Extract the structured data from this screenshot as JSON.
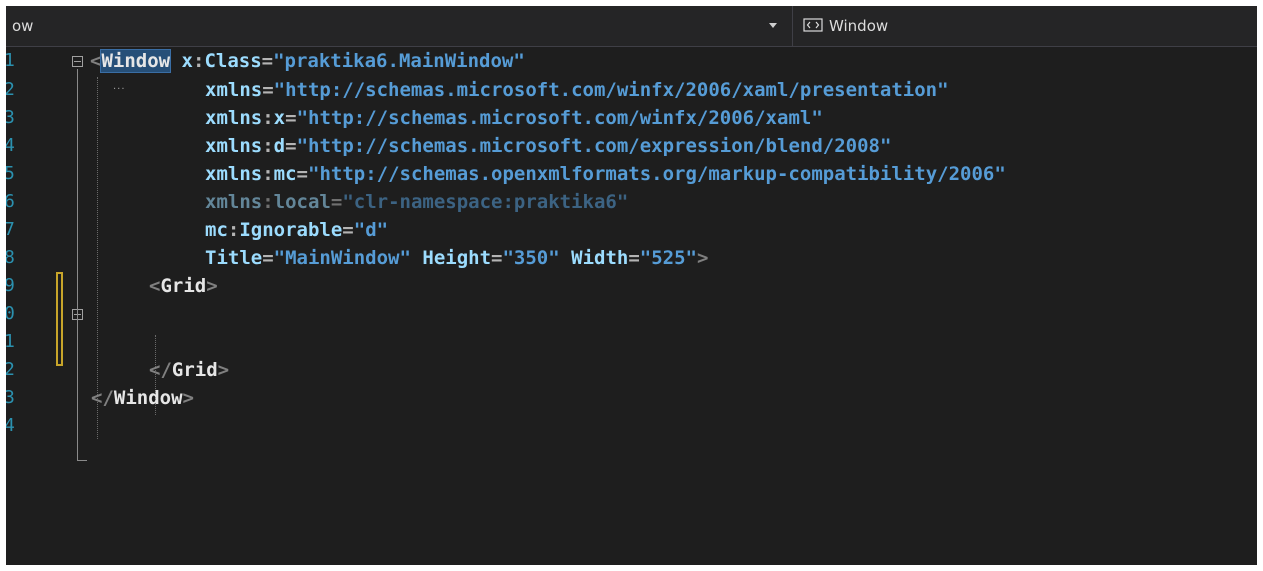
{
  "navigation_bar": {
    "left_text": "ow",
    "right_icon": "xaml-element-icon",
    "right_text": "Window"
  },
  "editor": {
    "lines": [
      {
        "number": "1",
        "tokens": [
          {
            "t": "<",
            "c": "br"
          },
          {
            "t": "Window",
            "c": "tag hl"
          },
          {
            "t": " ",
            "c": ""
          },
          {
            "t": "x",
            "c": "attr"
          },
          {
            "t": ":",
            "c": "eq"
          },
          {
            "t": "Class",
            "c": "attr"
          },
          {
            "t": "=",
            "c": "eq"
          },
          {
            "t": "\"praktika6.MainWindow\"",
            "c": "val"
          }
        ]
      },
      {
        "number": "2",
        "tokens": [
          {
            "t": "xmlns",
            "c": "attr"
          },
          {
            "t": "=",
            "c": "eq"
          },
          {
            "t": "\"http://schemas.microsoft.com/winfx/2006/xaml/presentation\"",
            "c": "val"
          }
        ]
      },
      {
        "number": "3",
        "tokens": [
          {
            "t": "xmlns",
            "c": "attr"
          },
          {
            "t": ":",
            "c": "eq"
          },
          {
            "t": "x",
            "c": "attr"
          },
          {
            "t": "=",
            "c": "eq"
          },
          {
            "t": "\"http://schemas.microsoft.com/winfx/2006/xaml\"",
            "c": "val"
          }
        ]
      },
      {
        "number": "4",
        "tokens": [
          {
            "t": "xmlns",
            "c": "attr"
          },
          {
            "t": ":",
            "c": "eq"
          },
          {
            "t": "d",
            "c": "attr"
          },
          {
            "t": "=",
            "c": "eq"
          },
          {
            "t": "\"http://schemas.microsoft.com/expression/blend/2008\"",
            "c": "val"
          }
        ]
      },
      {
        "number": "5",
        "tokens": [
          {
            "t": "xmlns",
            "c": "attr"
          },
          {
            "t": ":",
            "c": "eq"
          },
          {
            "t": "mc",
            "c": "attr"
          },
          {
            "t": "=",
            "c": "eq"
          },
          {
            "t": "\"http://schemas.openxmlformats.org/markup-compatibility/2006\"",
            "c": "val"
          }
        ]
      },
      {
        "number": "6",
        "tokens": [
          {
            "t": "xmlns",
            "c": "attr dim"
          },
          {
            "t": ":",
            "c": "eq dim"
          },
          {
            "t": "local",
            "c": "attr dim"
          },
          {
            "t": "=",
            "c": "eq dim"
          },
          {
            "t": "\"clr-namespace:praktika6\"",
            "c": "val dim"
          }
        ]
      },
      {
        "number": "7",
        "tokens": [
          {
            "t": "mc",
            "c": "attr"
          },
          {
            "t": ":",
            "c": "eq"
          },
          {
            "t": "Ignorable",
            "c": "attr"
          },
          {
            "t": "=",
            "c": "eq"
          },
          {
            "t": "\"d\"",
            "c": "val"
          }
        ]
      },
      {
        "number": "8",
        "tokens": [
          {
            "t": "Title",
            "c": "attr"
          },
          {
            "t": "=",
            "c": "eq"
          },
          {
            "t": "\"MainWindow\"",
            "c": "val"
          },
          {
            "t": " ",
            "c": ""
          },
          {
            "t": "Height",
            "c": "attr"
          },
          {
            "t": "=",
            "c": "eq"
          },
          {
            "t": "\"350\"",
            "c": "val"
          },
          {
            "t": " ",
            "c": ""
          },
          {
            "t": "Width",
            "c": "attr"
          },
          {
            "t": "=",
            "c": "eq"
          },
          {
            "t": "\"525\"",
            "c": "val"
          },
          {
            "t": ">",
            "c": "br"
          }
        ]
      },
      {
        "number": "9",
        "tokens": [
          {
            "t": "<",
            "c": "br"
          },
          {
            "t": "Grid",
            "c": "tag"
          },
          {
            "t": ">",
            "c": "br"
          }
        ]
      },
      {
        "number": "0",
        "tokens": []
      },
      {
        "number": "1",
        "tokens": []
      },
      {
        "number": "2",
        "tokens": [
          {
            "t": "</",
            "c": "br"
          },
          {
            "t": "Grid",
            "c": "tag"
          },
          {
            "t": ">",
            "c": "br"
          }
        ]
      },
      {
        "number": "3",
        "tokens": [
          {
            "t": "</",
            "c": "br"
          },
          {
            "t": "Window",
            "c": "tag"
          },
          {
            "t": ">",
            "c": "br"
          }
        ]
      },
      {
        "number": "4",
        "tokens": []
      }
    ],
    "collapsed_hint": "...",
    "colors": {
      "background": "#1e1e1e",
      "line_number": "#2b91af",
      "element": "#e6e6e6",
      "attribute": "#9cdcfe",
      "value": "#569cd6",
      "bracket": "#808080",
      "change_marker": "#c8a52a"
    }
  }
}
